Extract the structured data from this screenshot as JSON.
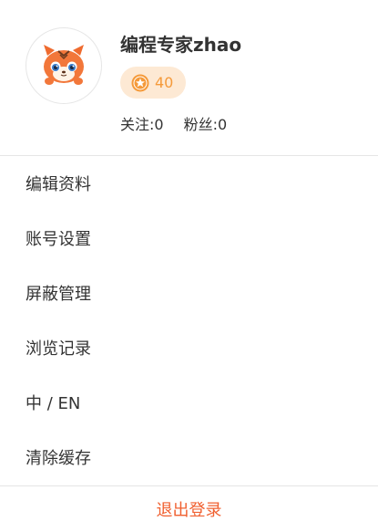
{
  "profile": {
    "username": "编程专家zhao",
    "points": "40",
    "following": "关注:0",
    "followers": "粉丝:0"
  },
  "menu": {
    "items": [
      {
        "label": "编辑资料"
      },
      {
        "label": "账号设置"
      },
      {
        "label": "屏蔽管理"
      },
      {
        "label": "浏览记录"
      },
      {
        "label": "中 / EN"
      },
      {
        "label": "清除缓存"
      }
    ]
  },
  "footer": {
    "logout_label": "退出登录"
  },
  "colors": {
    "accent": "#f59a3a",
    "badge_bg": "#fde9d4",
    "logout": "#f06030"
  },
  "icons": {
    "avatar": "tiger-mascot-avatar",
    "points": "star-coin-icon"
  }
}
